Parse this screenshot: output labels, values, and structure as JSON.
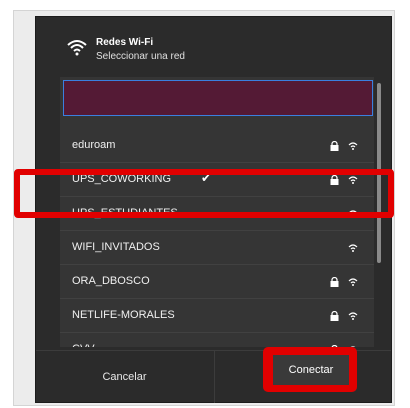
{
  "dialog": {
    "title": "Redes Wi-Fi",
    "subtitle": "Seleccionar una red",
    "search_value": ""
  },
  "networks": [
    {
      "name": "eduroam",
      "locked": true,
      "connected": false,
      "icon": "wifi-signal-icon"
    },
    {
      "name": "UPS_COWORKING",
      "locked": true,
      "connected": true,
      "icon": "wifi-signal-icon"
    },
    {
      "name": "UPS_ESTUDIANTES",
      "locked": false,
      "connected": false,
      "icon": "wifi-signal-icon"
    },
    {
      "name": "WIFI_INVITADOS",
      "locked": false,
      "connected": false,
      "icon": "wifi-signal-icon"
    },
    {
      "name": "ORA_DBOSCO",
      "locked": true,
      "connected": false,
      "icon": "wifi-signal-icon"
    },
    {
      "name": "NETLIFE-MORALES",
      "locked": true,
      "connected": false,
      "icon": "wifi-signal-icon"
    },
    {
      "name": "CVV",
      "locked": true,
      "connected": false,
      "icon": "wifi-signal-icon"
    }
  ],
  "footer": {
    "cancel_label": "Cancelar",
    "connect_label": "Conectar"
  },
  "colors": {
    "dialog_bg": "#2b2b2b",
    "search_bg": "#541a35",
    "highlight": "#e10000"
  }
}
